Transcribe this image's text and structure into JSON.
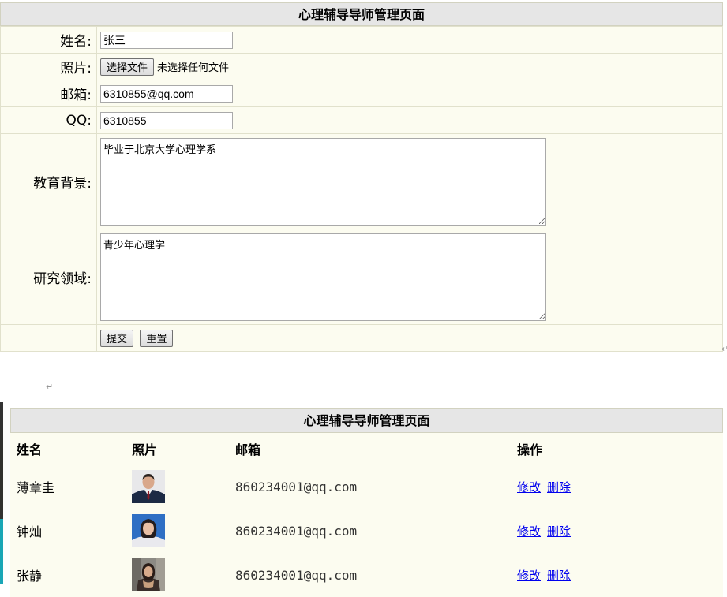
{
  "form": {
    "title": "心理辅导导师管理页面",
    "name_label": "姓名:",
    "name_value": "张三",
    "photo_label": "照片:",
    "choose_file_label": "选择文件",
    "no_file_text": "未选择任何文件",
    "email_label": "邮箱:",
    "email_value": "6310855@qq.com",
    "qq_label": "QQ:",
    "qq_value": "6310855",
    "education_label": "教育背景:",
    "education_value": "毕业于北京大学心理学系",
    "research_label": "研究领域:",
    "research_value": "青少年心理学",
    "submit_label": "提交",
    "reset_label": "重置"
  },
  "list": {
    "title": "心理辅导导师管理页面",
    "headers": [
      "姓名",
      "照片",
      "邮箱",
      "操作"
    ],
    "rows": [
      {
        "name": "薄章圭",
        "email": "860234001@qq.com",
        "edit": "修改",
        "delete": "删除"
      },
      {
        "name": "钟灿",
        "email": "860234001@qq.com",
        "edit": "修改",
        "delete": "删除"
      },
      {
        "name": "张静",
        "email": "860234001@qq.com",
        "edit": "修改",
        "delete": "删除"
      }
    ]
  },
  "colors": {
    "title_bg": "#e6e6e6",
    "row_bg": "#fcfcf0",
    "border": "#e1e1cc",
    "link": "#0000ee",
    "accent_bar": "#1aa6b7"
  }
}
